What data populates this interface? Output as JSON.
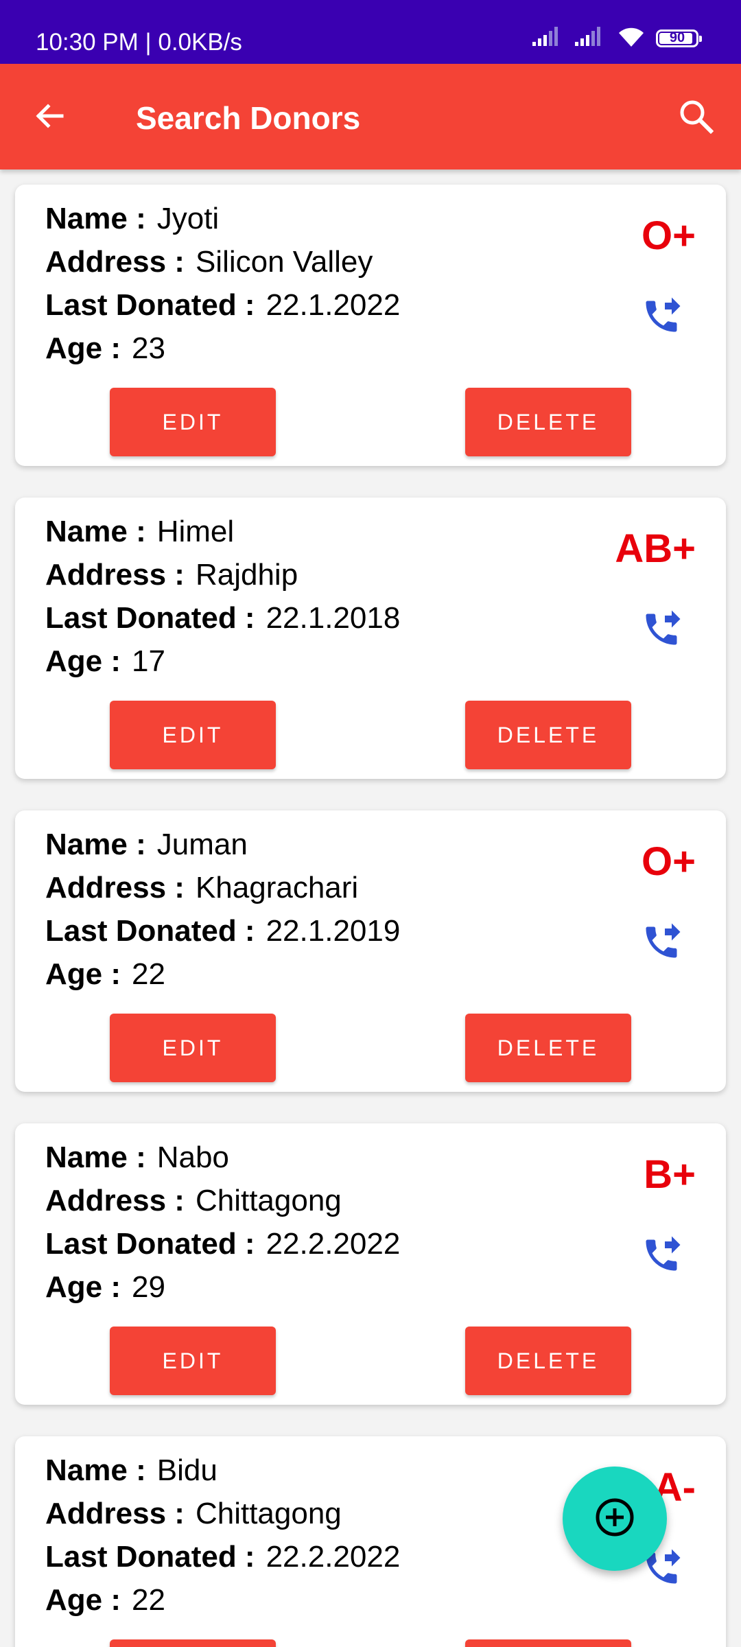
{
  "status_bar": {
    "time_speed": "10:30 PM | 0.0KB/s",
    "battery_level": "90"
  },
  "app_bar": {
    "title": "Search Donors",
    "back_icon": "arrow-back-icon",
    "search_icon": "search-icon"
  },
  "labels": {
    "name": "Name :",
    "address": "Address :",
    "last_donated": "Last Donated :",
    "age": "Age :",
    "edit": "EDIT",
    "delete": "DELETE"
  },
  "colors": {
    "status_bar": "#3a00b1",
    "app_bar": "#f44336",
    "button": "#f44336",
    "blood_group": "#e8000b",
    "call_icon": "#2f53d3",
    "fab": "#19d7bf"
  },
  "donors": [
    {
      "name": "Jyoti",
      "address": "Silicon Valley",
      "last_donated": "22.1.2022",
      "age": "23",
      "blood_group": "O+"
    },
    {
      "name": "Himel",
      "address": "Rajdhip",
      "last_donated": "22.1.2018",
      "age": "17",
      "blood_group": "AB+"
    },
    {
      "name": "Juman",
      "address": "Khagrachari",
      "last_donated": "22.1.2019",
      "age": "22",
      "blood_group": "O+"
    },
    {
      "name": "Nabo",
      "address": "Chittagong",
      "last_donated": "22.2.2022",
      "age": "29",
      "blood_group": "B+"
    },
    {
      "name": "Bidu",
      "address": "Chittagong",
      "last_donated": "22.2.2022",
      "age": "22",
      "blood_group": "A-"
    }
  ],
  "fab_icon": "add-circle-icon"
}
